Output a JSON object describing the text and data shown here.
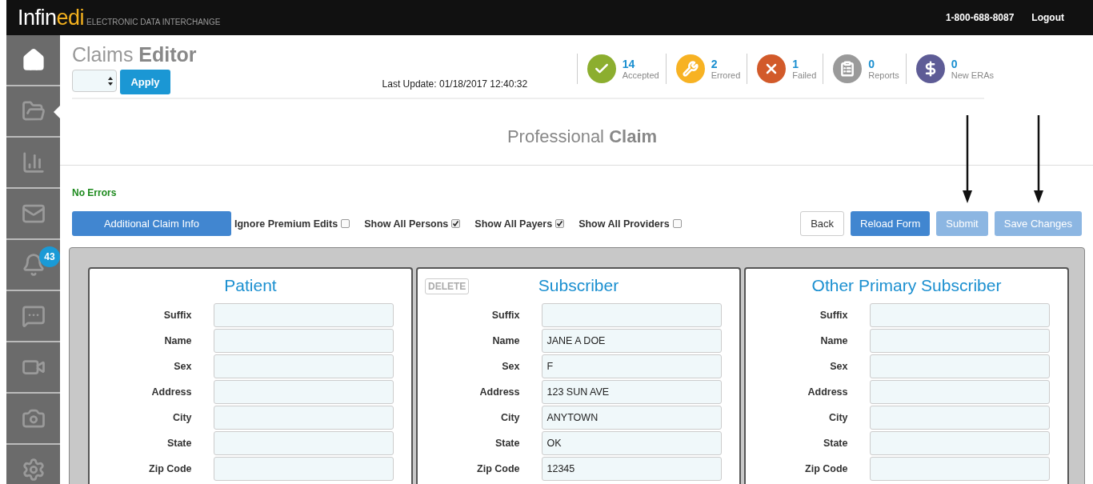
{
  "header": {
    "brand_main": "Infin",
    "brand_accent": "edi",
    "tagline": "ELECTRONIC DATA INTERCHANGE",
    "phone": "1-800-688-8087",
    "logout": "Logout"
  },
  "sidebar": {
    "items": [
      {
        "kind": "home",
        "selected": false,
        "highlighted": true
      },
      {
        "kind": "claims",
        "selected": true,
        "highlighted": false
      },
      {
        "kind": "chart",
        "selected": false,
        "highlighted": false
      },
      {
        "kind": "mail",
        "selected": false,
        "highlighted": false
      },
      {
        "kind": "bell",
        "selected": false,
        "highlighted": false,
        "badge": "43"
      },
      {
        "kind": "chat",
        "selected": false,
        "highlighted": false
      },
      {
        "kind": "video",
        "selected": false,
        "highlighted": false
      },
      {
        "kind": "camera",
        "selected": false,
        "highlighted": false
      },
      {
        "kind": "settings",
        "selected": false,
        "highlighted": false
      }
    ]
  },
  "page": {
    "title_light": "Claims",
    "title_bold": "Editor",
    "apply": "Apply",
    "last_update": "Last Update: 01/18/2017 12:40:32"
  },
  "status": [
    {
      "kind": "check",
      "count": "14",
      "label": "Accepted",
      "color": "#8cae2f"
    },
    {
      "kind": "wrench",
      "count": "2",
      "label": "Errored",
      "color": "#f7b223"
    },
    {
      "kind": "cross",
      "count": "1",
      "label": "Failed",
      "color": "#d25a2a"
    },
    {
      "kind": "clipboard",
      "count": "0",
      "label": "Reports",
      "color": "#9a9a9a"
    },
    {
      "kind": "dollar",
      "count": "0",
      "label": "New ERAs",
      "color": "#5e5c96"
    }
  ],
  "form": {
    "title_light": "Professional",
    "title_bold": "Claim",
    "errors": "No Errors",
    "additional": "Additional Claim Info",
    "options": [
      {
        "label": "Ignore Premium Edits",
        "checked": false
      },
      {
        "label": "Show All Persons",
        "checked": true
      },
      {
        "label": "Show All Payers",
        "checked": true
      },
      {
        "label": "Show All Providers",
        "checked": false
      }
    ],
    "buttons": [
      {
        "label": "Back",
        "kind": "default",
        "disabled": false
      },
      {
        "label": "Reload Form",
        "kind": "primary",
        "disabled": false
      },
      {
        "label": "Submit",
        "kind": "primary",
        "disabled": true
      },
      {
        "label": "Save Changes",
        "kind": "primary",
        "disabled": true
      }
    ]
  },
  "panels": [
    {
      "title": "Patient",
      "fields": [
        {
          "label": "Suffix"
        },
        {
          "label": "Name"
        },
        {
          "label": "Sex"
        },
        {
          "label": "Address"
        },
        {
          "label": "City"
        },
        {
          "label": "State"
        },
        {
          "label": "Zip Code"
        }
      ]
    },
    {
      "title": "Subscriber",
      "delete": "DELETE",
      "fields": [
        {
          "label": "Suffix"
        },
        {
          "label": "Name",
          "value": "JANE A DOE"
        },
        {
          "label": "Sex",
          "value": "F"
        },
        {
          "label": "Address",
          "value": "123 SUN AVE"
        },
        {
          "label": "City",
          "value": "ANYTOWN"
        },
        {
          "label": "State",
          "value": "OK"
        },
        {
          "label": "Zip Code",
          "value": "12345"
        }
      ]
    },
    {
      "title": "Other Primary Subscriber",
      "fields": [
        {
          "label": "Suffix"
        },
        {
          "label": "Name"
        },
        {
          "label": "Sex"
        },
        {
          "label": "Address"
        },
        {
          "label": "City"
        },
        {
          "label": "State"
        },
        {
          "label": "Zip Code"
        }
      ]
    }
  ]
}
